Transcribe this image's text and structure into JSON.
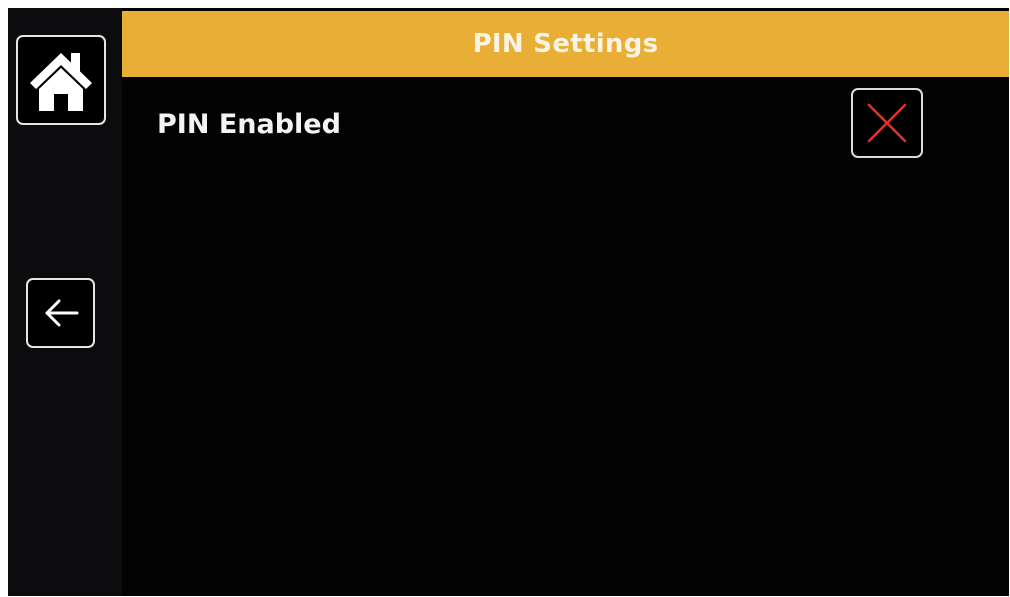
{
  "header": {
    "title": "PIN Settings",
    "background_color": "#e9ae36"
  },
  "sidebar": {
    "buttons": [
      {
        "name": "home",
        "icon": "home-icon"
      },
      {
        "name": "back",
        "icon": "arrow-left-icon"
      }
    ]
  },
  "settings": {
    "pin_enabled": {
      "label": "PIN Enabled",
      "checked": false,
      "icon": "x-mark-icon",
      "icon_color": "#e0322a"
    }
  }
}
